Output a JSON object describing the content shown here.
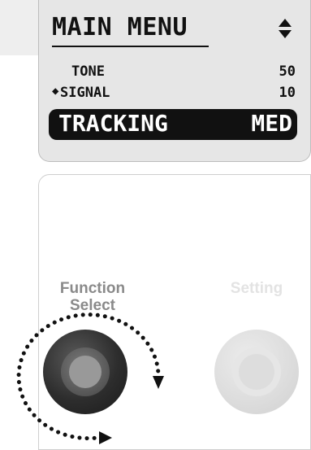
{
  "lcd": {
    "title": "MAIN MENU",
    "items": [
      {
        "label": "TONE",
        "value": "50"
      },
      {
        "label": "SIGNAL",
        "value": "10",
        "marker": "◆"
      },
      {
        "label": "TRACKING",
        "value": "MED"
      }
    ]
  },
  "controls": {
    "function_label": "Function Select",
    "setting_label": "Setting"
  },
  "colors": {
    "lcd_background": "#e6e6e6",
    "selected_row": "#111111",
    "function_knob": "#2d2d2d",
    "setting_knob": "#dcdcdc",
    "setting_label": "#e3e3e3",
    "function_label": "#8a8a8a"
  },
  "icons": {
    "scroll": "up-down-triangle-icon",
    "rotation": "rotation-arrow-icon"
  }
}
